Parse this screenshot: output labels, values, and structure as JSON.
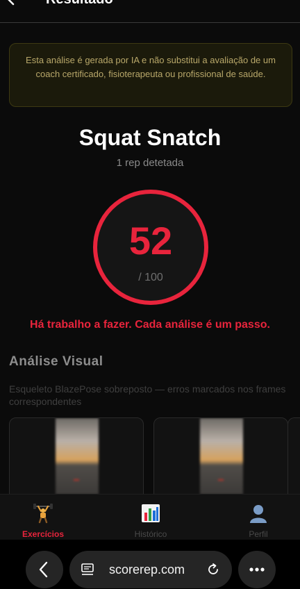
{
  "header": {
    "title": "Resultado"
  },
  "disclaimer": {
    "text": "Esta análise é gerada por IA e não substitui a avaliação de um coach certificado, fisioterapeuta ou profissional de saúde."
  },
  "result": {
    "exercise_name": "Squat Snatch",
    "reps_detected": "1 rep detetada",
    "score": "52",
    "score_max": "/ 100",
    "message": "Há trabalho a fazer. Cada análise é um passo."
  },
  "visual_analysis": {
    "title": "Análise Visual",
    "description": "Esqueleto BlazePose sobreposto — erros marcados nos frames correspondentes"
  },
  "bottom_nav": {
    "items": [
      {
        "label": "Exercícios",
        "icon": "weightlifter-icon",
        "active": true
      },
      {
        "label": "Histórico",
        "icon": "bar-chart-icon",
        "active": false
      },
      {
        "label": "Perfil",
        "icon": "user-silhouette-icon",
        "active": false
      }
    ]
  },
  "browser": {
    "url": "scorerep.com"
  },
  "colors": {
    "accent": "#e8243c",
    "background": "#0b0b0b",
    "disclaimer_text": "#b9a86a"
  }
}
